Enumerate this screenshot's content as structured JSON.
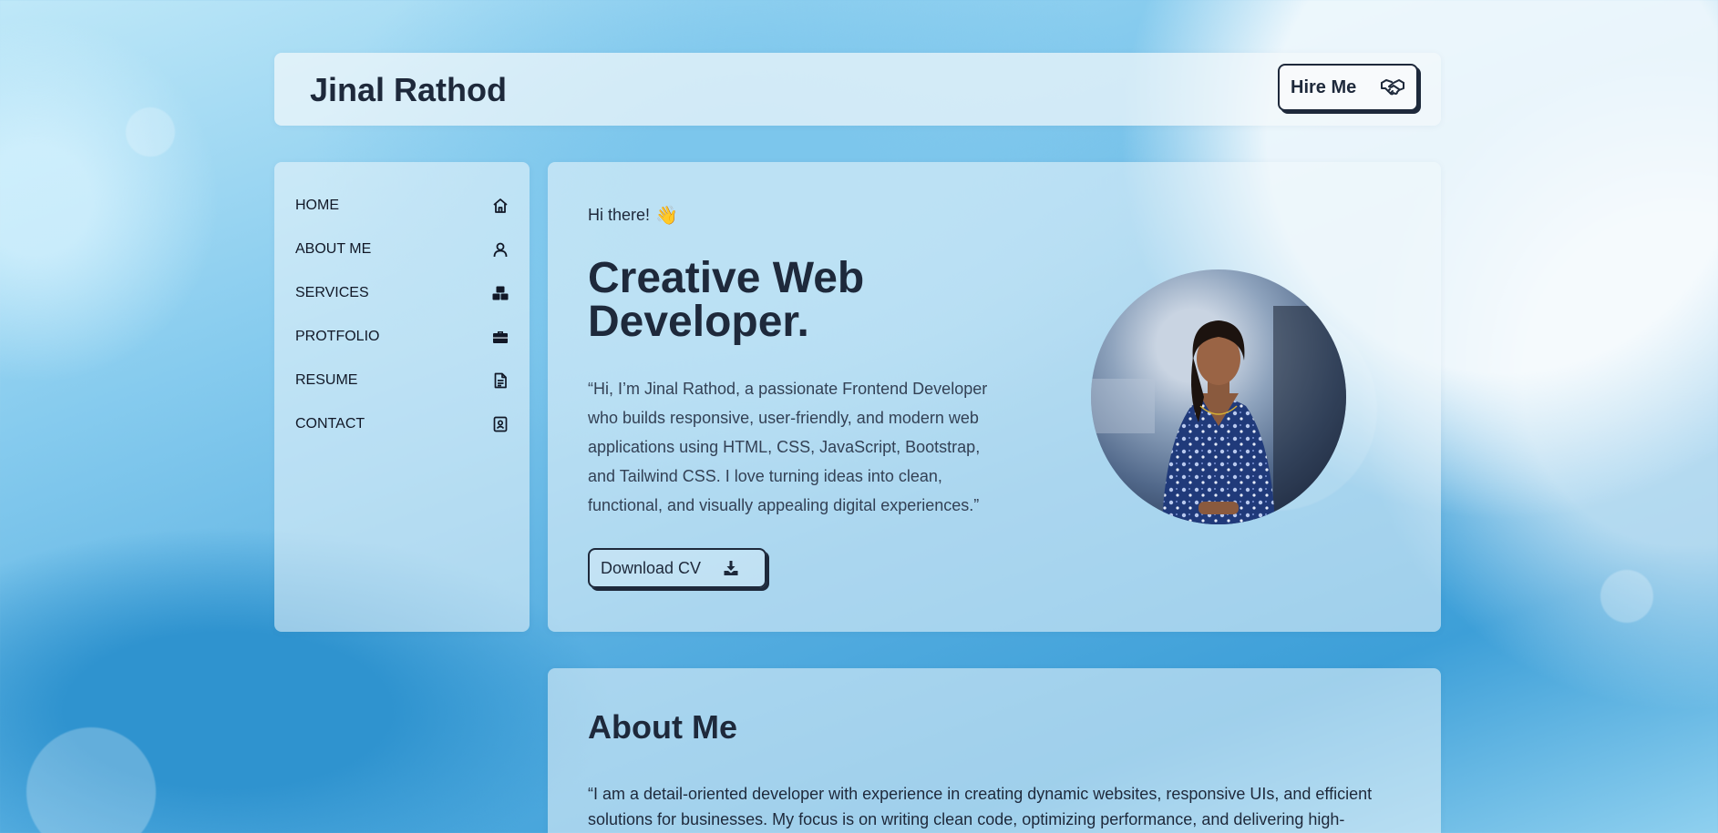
{
  "header": {
    "brand": "Jinal Rathod",
    "hire_label": "Hire Me",
    "hire_icon": "handshake-icon"
  },
  "sidebar": {
    "items": [
      {
        "label": "HOME",
        "icon": "home-icon"
      },
      {
        "label": "ABOUT ME",
        "icon": "user-icon"
      },
      {
        "label": "SERVICES",
        "icon": "boxes-icon"
      },
      {
        "label": "PROTFOLIO",
        "icon": "briefcase-icon"
      },
      {
        "label": "RESUME",
        "icon": "document-icon"
      },
      {
        "label": "CONTACT",
        "icon": "contact-card-icon"
      }
    ]
  },
  "hero": {
    "greeting": "Hi there!",
    "greeting_emoji": "👋",
    "title": "Creative Web Developer.",
    "description": "“Hi, I’m Jinal Rathod, a passionate Frontend Developer who builds responsive, user-friendly, and modern web applications using HTML, CSS, JavaScript, Bootstrap, and Tailwind CSS. I love turning ideas into clean, functional, and visually appealing digital experiences.”",
    "download_label": "Download CV",
    "download_icon": "download-icon"
  },
  "about": {
    "title": "About Me",
    "text": "“I am a detail-oriented developer with experience in creating dynamic websites, responsive UIs, and efficient solutions for businesses. My focus is on writing clean code, optimizing performance, and delivering high-"
  },
  "colors": {
    "text_dark": "#1e293b",
    "panel": "#f0f8fc",
    "accent_blue": "#3d9fd8"
  }
}
